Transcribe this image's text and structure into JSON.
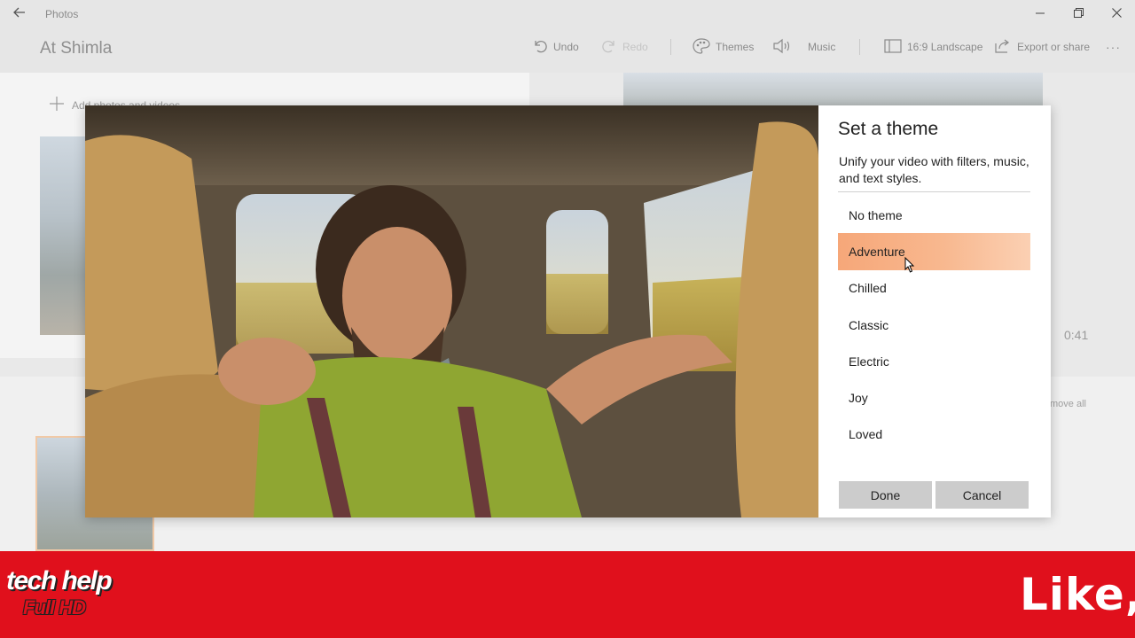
{
  "window": {
    "app_title": "Photos",
    "back_icon": "back-arrow-icon",
    "minimize_icon": "minimize-icon",
    "restore_icon": "restore-icon",
    "close_icon": "close-icon"
  },
  "project": {
    "title": "At Shimla"
  },
  "toolbar": {
    "undo": "Undo",
    "redo": "Redo",
    "themes": "Themes",
    "music": "Music",
    "aspect": "16:9 Landscape",
    "export": "Export or share",
    "more": "···"
  },
  "library": {
    "add_label": "Add photos and videos"
  },
  "preview": {
    "duration": "0:41"
  },
  "storyboard": {
    "remove_all": "move all"
  },
  "theme_dialog": {
    "title": "Set a theme",
    "description": "Unify your video with filters, music, and text styles.",
    "themes": [
      "No theme",
      "Adventure",
      "Chilled",
      "Classic",
      "Electric",
      "Joy",
      "Loved"
    ],
    "selected": "Adventure",
    "done_label": "Done",
    "cancel_label": "Cancel",
    "accent_color": "#f6a779"
  },
  "banner": {
    "brand": "tech help",
    "brand_sub": "Full HD",
    "like": "Like,",
    "color": "#e0101c"
  }
}
